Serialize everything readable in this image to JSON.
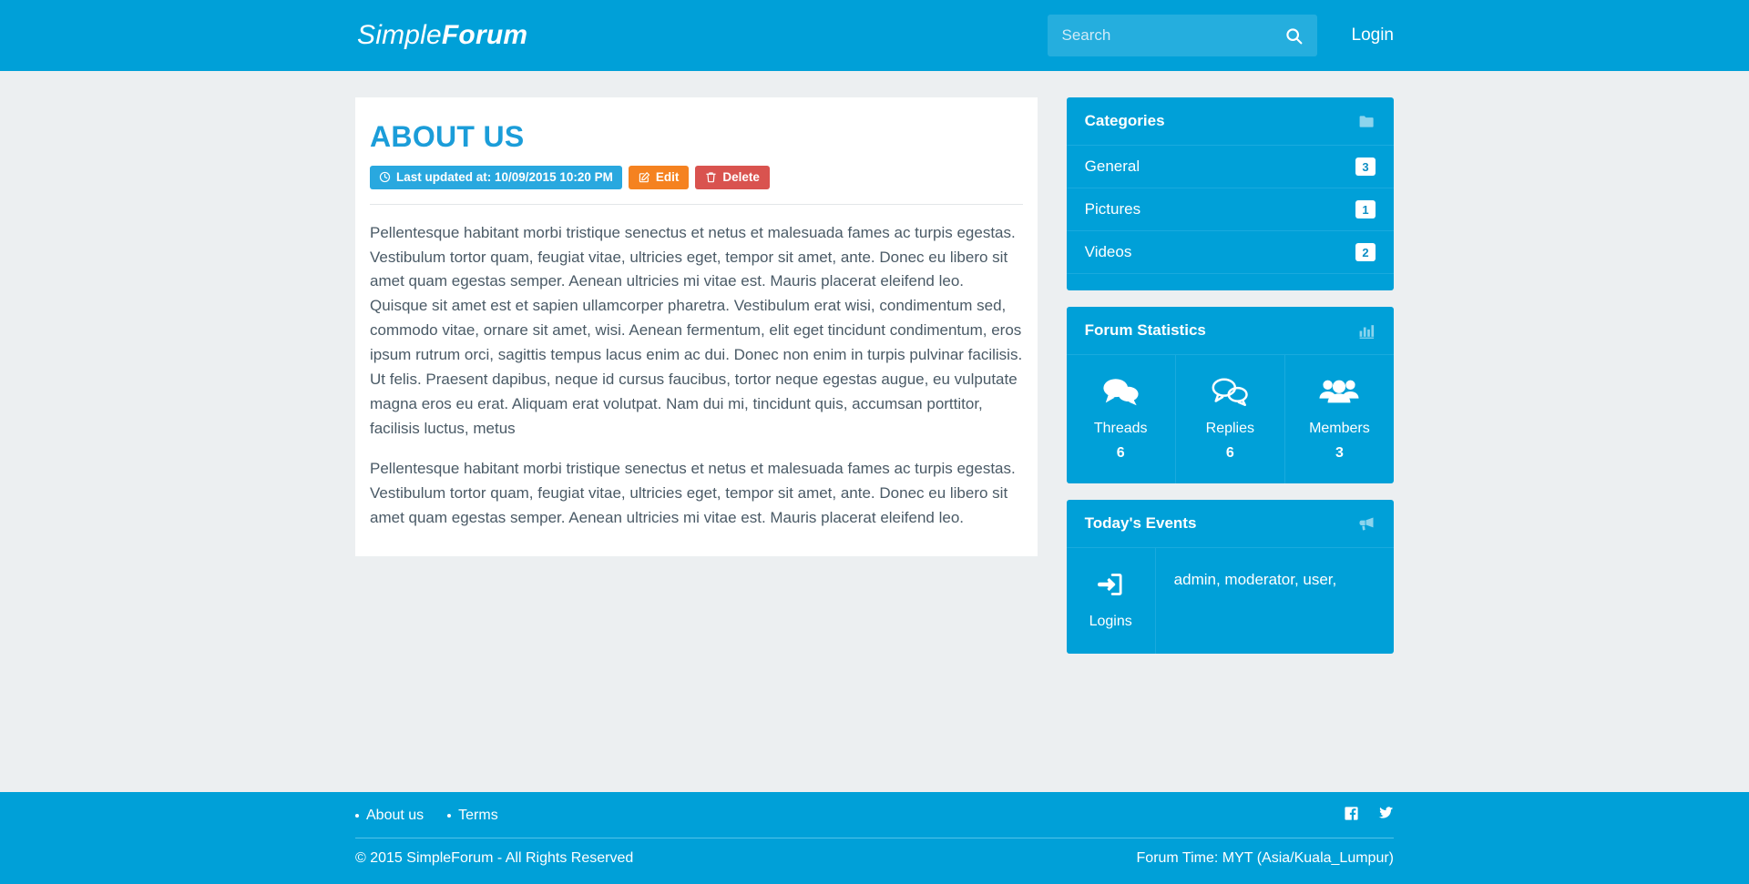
{
  "header": {
    "brand_light": "Simple",
    "brand_bold": "Forum",
    "search": {
      "value": "",
      "placeholder": "Search",
      "icon": "search-icon"
    },
    "login_label": "Login"
  },
  "article": {
    "title": "About Us",
    "updated_badge": "Last updated at: 10/09/2015 10:20 PM",
    "updated_icon": "clock-icon",
    "edit_label": "Edit",
    "edit_icon": "pencil-square-icon",
    "delete_label": "Delete",
    "delete_icon": "trash-icon",
    "paragraphs": [
      "Pellentesque habitant morbi tristique senectus et netus et malesuada fames ac turpis egestas. Vestibulum tortor quam, feugiat vitae, ultricies eget, tempor sit amet, ante. Donec eu libero sit amet quam egestas semper. Aenean ultricies mi vitae est. Mauris placerat eleifend leo. Quisque sit amet est et sapien ullamcorper pharetra. Vestibulum erat wisi, condimentum sed, commodo vitae, ornare sit amet, wisi. Aenean fermentum, elit eget tincidunt condimentum, eros ipsum rutrum orci, sagittis tempus lacus enim ac dui. Donec non enim in turpis pulvinar facilisis. Ut felis. Praesent dapibus, neque id cursus faucibus, tortor neque egestas augue, eu vulputate magna eros eu erat. Aliquam erat volutpat. Nam dui mi, tincidunt quis, accumsan porttitor, facilisis luctus, metus",
      "Pellentesque habitant morbi tristique senectus et netus et malesuada fames ac turpis egestas. Vestibulum tortor quam, feugiat vitae, ultricies eget, tempor sit amet, ante. Donec eu libero sit amet quam egestas semper. Aenean ultricies mi vitae est. Mauris placerat eleifend leo."
    ]
  },
  "categories": {
    "title": "Categories",
    "icon": "folder-icon",
    "items": [
      {
        "label": "General",
        "count": "3"
      },
      {
        "label": "Pictures",
        "count": "1"
      },
      {
        "label": "Videos",
        "count": "2"
      }
    ]
  },
  "statistics": {
    "title": "Forum Statistics",
    "icon": "bar-chart-icon",
    "items": [
      {
        "label": "Threads",
        "value": "6",
        "icon": "comments-filled-icon"
      },
      {
        "label": "Replies",
        "value": "6",
        "icon": "comments-outline-icon"
      },
      {
        "label": "Members",
        "value": "3",
        "icon": "users-icon"
      }
    ]
  },
  "events": {
    "title": "Today's Events",
    "icon": "bullhorn-icon",
    "row_label": "Logins",
    "row_icon": "sign-in-icon",
    "row_value": "admin, moderator, user,"
  },
  "footer": {
    "links": [
      {
        "label": "About us"
      },
      {
        "label": "Terms"
      }
    ],
    "social": [
      {
        "name": "facebook-icon"
      },
      {
        "name": "twitter-icon"
      }
    ],
    "copyright": "© 2015 SimpleForum - All Rights Reserved",
    "forum_time": "Forum Time: MYT (Asia/Kuala_Lumpur)"
  },
  "colors": {
    "brand_blue": "#00a0d8",
    "search_blue": "#25aede",
    "title_blue": "#1b9dd9",
    "edit_orange": "#f58220",
    "delete_red": "#d9534f",
    "page_bg": "#eceff1"
  }
}
